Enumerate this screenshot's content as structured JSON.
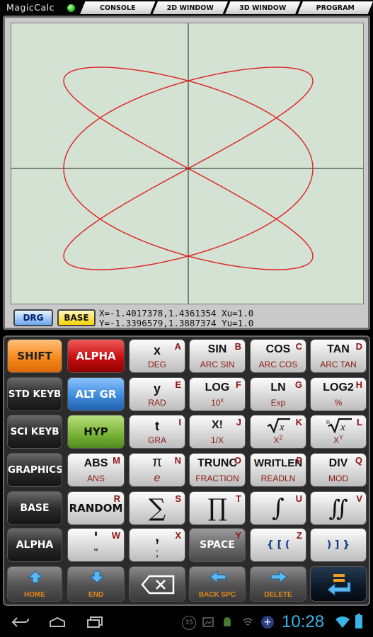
{
  "app": {
    "title": "MagicCalc"
  },
  "tabs": [
    "CONSOLE",
    "2D WINDOW",
    "3D WINDOW",
    "PROGRAM"
  ],
  "graph": {
    "drg_label": "DRG",
    "base_label": "BASE",
    "coord_line1": "X=-1.4017378,1.4361354 Xu=1.0",
    "coord_line2": "Y=-1.3396579,1.3887374 Yu=1.0",
    "curve_color": "#e02020"
  },
  "keys": {
    "shift": "SHIFT",
    "alpha_top": "ALPHA",
    "x_main": "x",
    "x_sub": "DEG",
    "x_corner": "A",
    "sin_main": "SIN",
    "sin_sub": "ARC SIN",
    "sin_corner": "B",
    "cos_main": "COS",
    "cos_sub": "ARC COS",
    "cos_corner": "C",
    "tan_main": "TAN",
    "tan_sub": "ARC TAN",
    "tan_corner": "D",
    "std_keyb": "STD KEYB",
    "alt_gr": "ALT GR",
    "y_main": "y",
    "y_sub": "RAD",
    "y_corner": "E",
    "log_main": "LOG",
    "log_sub": "10",
    "log_sub_sup": "x",
    "log_corner": "F",
    "ln_main": "LN",
    "ln_sub": "Exp",
    "ln_corner": "G",
    "log2_main": "LOG2",
    "log2_sub": "%",
    "log2_corner": "H",
    "sci_keyb": "SCI KEYB",
    "hyp": "HYP",
    "t_main": "t",
    "t_sub": "GRA",
    "t_corner": "I",
    "fact_main": "X!",
    "fact_sub": "1/X",
    "fact_corner": "J",
    "sqrt_sub": "X",
    "sqrt_sub_sup": "2",
    "sqrt_corner": "K",
    "nroot_sub": "X",
    "nroot_sub_sup": "Y",
    "nroot_corner": "L",
    "graphics": "GRAPHICS",
    "abs_main": "ABS",
    "abs_sub": "ANS",
    "abs_corner": "M",
    "pi_main": "π",
    "pi_sub": "e",
    "pi_corner": "N",
    "trunc_main": "TRUNC",
    "trunc_sub": "FRACTION",
    "trunc_corner": "O",
    "writeln_main": "WRITLEN",
    "writeln_sub": "READLN",
    "writeln_corner": "P",
    "div_main": "DIV",
    "div_sub": "MOD",
    "div_corner": "Q",
    "base_key": "BASE",
    "random_main": "RANDOM",
    "random_corner": "R",
    "sum_glyph": "∑",
    "sum_corner": "S",
    "prod_glyph": "∏",
    "prod_corner": "T",
    "int_glyph": "∫",
    "int_corner": "U",
    "dint_glyph": "∬",
    "dint_corner": "V",
    "alpha_bottom": "ALPHA",
    "quote_main": "'",
    "quote_sub": "\"",
    "quote_corner": "W",
    "comma_main": ",",
    "comma_sub": ";",
    "comma_corner": "X",
    "space_main": "SPACE",
    "space_corner": "Y",
    "open_br_main": "{ [ (",
    "open_br_corner": "Z",
    "close_br_main": ") ] }",
    "home": "HOME",
    "end": "END",
    "backspc": "BACK SPC",
    "delete": "DELETE"
  },
  "status": {
    "time": "10:28",
    "notify_count": "35"
  }
}
